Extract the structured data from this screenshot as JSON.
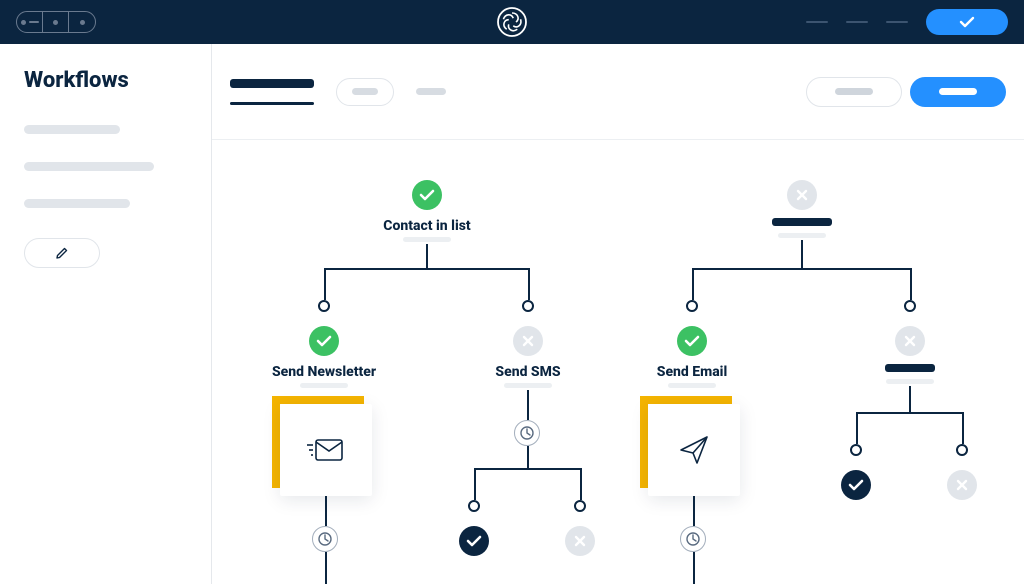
{
  "topbar": {
    "logo_name": "app-logo"
  },
  "sidebar": {
    "title": "Workflows"
  },
  "nodes": {
    "root": "Contact in list",
    "send_newsletter": "Send Newsletter",
    "send_sms": "Send SMS",
    "send_email": "Send Email"
  }
}
